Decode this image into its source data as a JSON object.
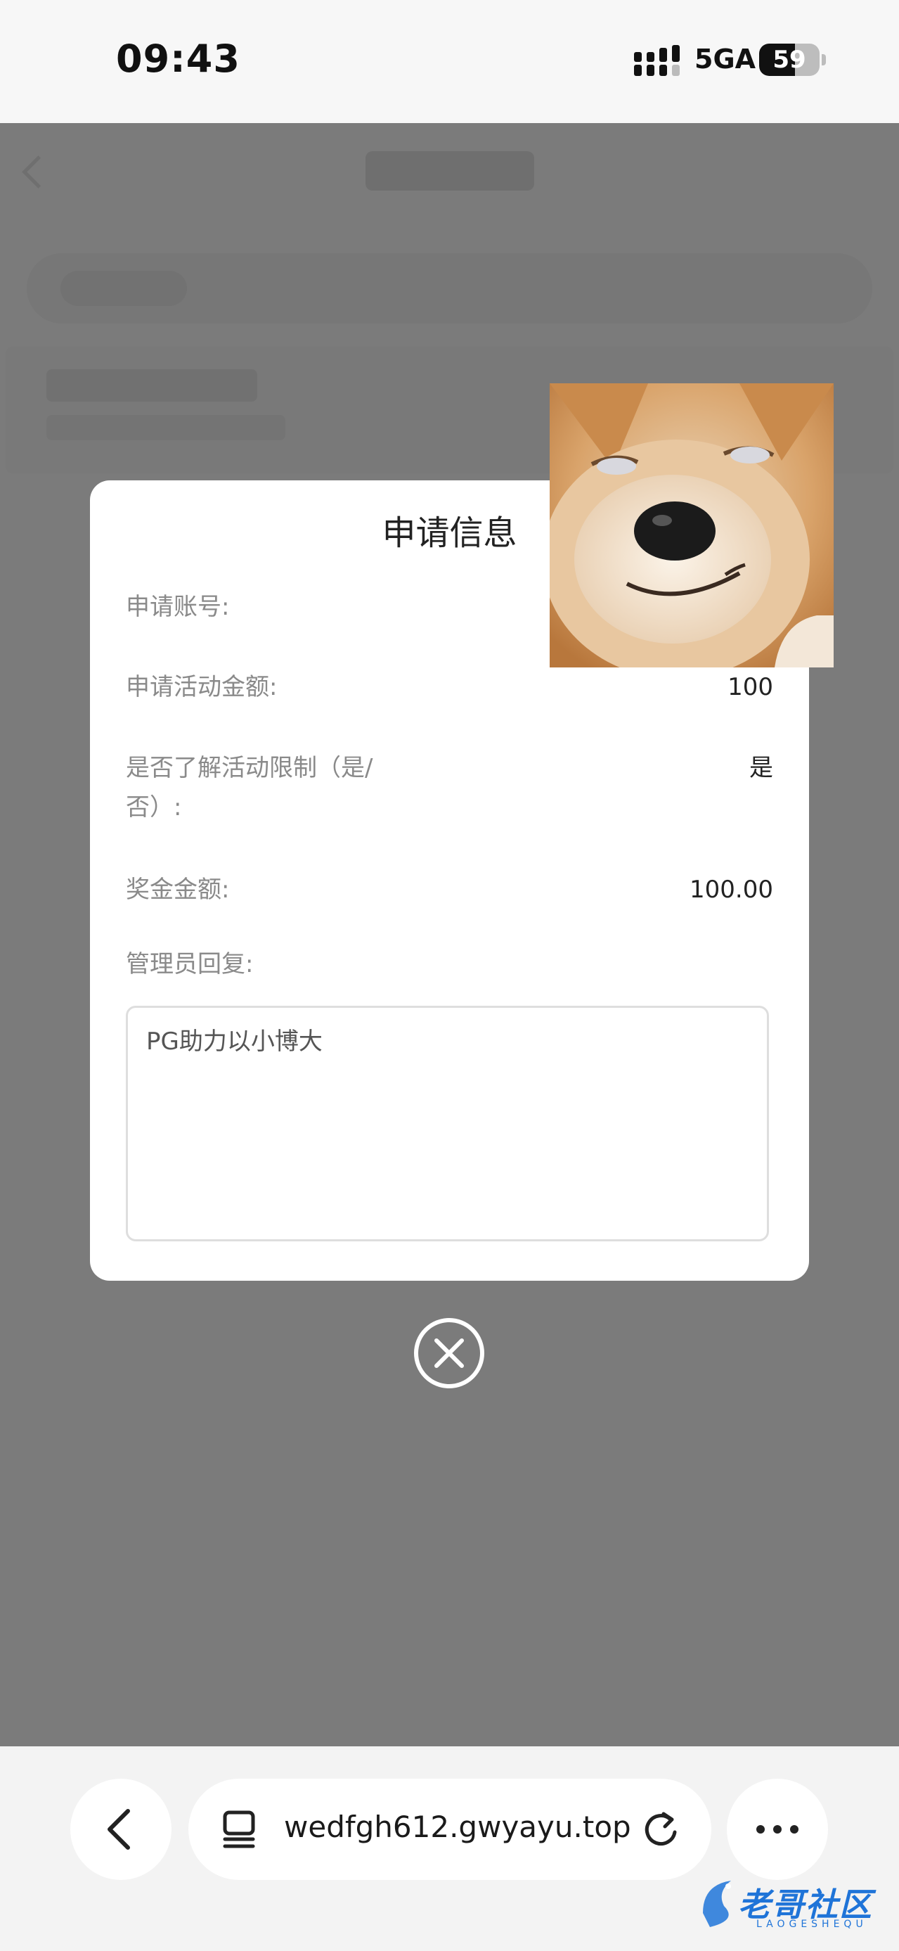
{
  "status_bar": {
    "time": "09:43",
    "network": "5GA",
    "battery_level": 59,
    "battery_text": "59"
  },
  "browser": {
    "url": "wedfgh612.gwyayu.top"
  },
  "dialog": {
    "title": "申请信息",
    "rows": [
      {
        "label": "申请账号:",
        "value": ""
      },
      {
        "label": "申请活动金额:",
        "value": "100"
      },
      {
        "label": "是否了解活动限制（是/否）:",
        "value": "是"
      },
      {
        "label": "奖金金额:",
        "value": "100.00"
      }
    ],
    "admin_reply_label": "管理员回复:",
    "admin_reply_text": "PG助力以小博大"
  },
  "watermark": {
    "text": "老哥社区",
    "subtext": "LAOGESHEQU"
  },
  "colors": {
    "overlay": "#7b7b7b",
    "dialog_bg": "#ffffff",
    "label": "#8a8a8a",
    "value": "#222222",
    "watermark": "#1f74d8"
  }
}
